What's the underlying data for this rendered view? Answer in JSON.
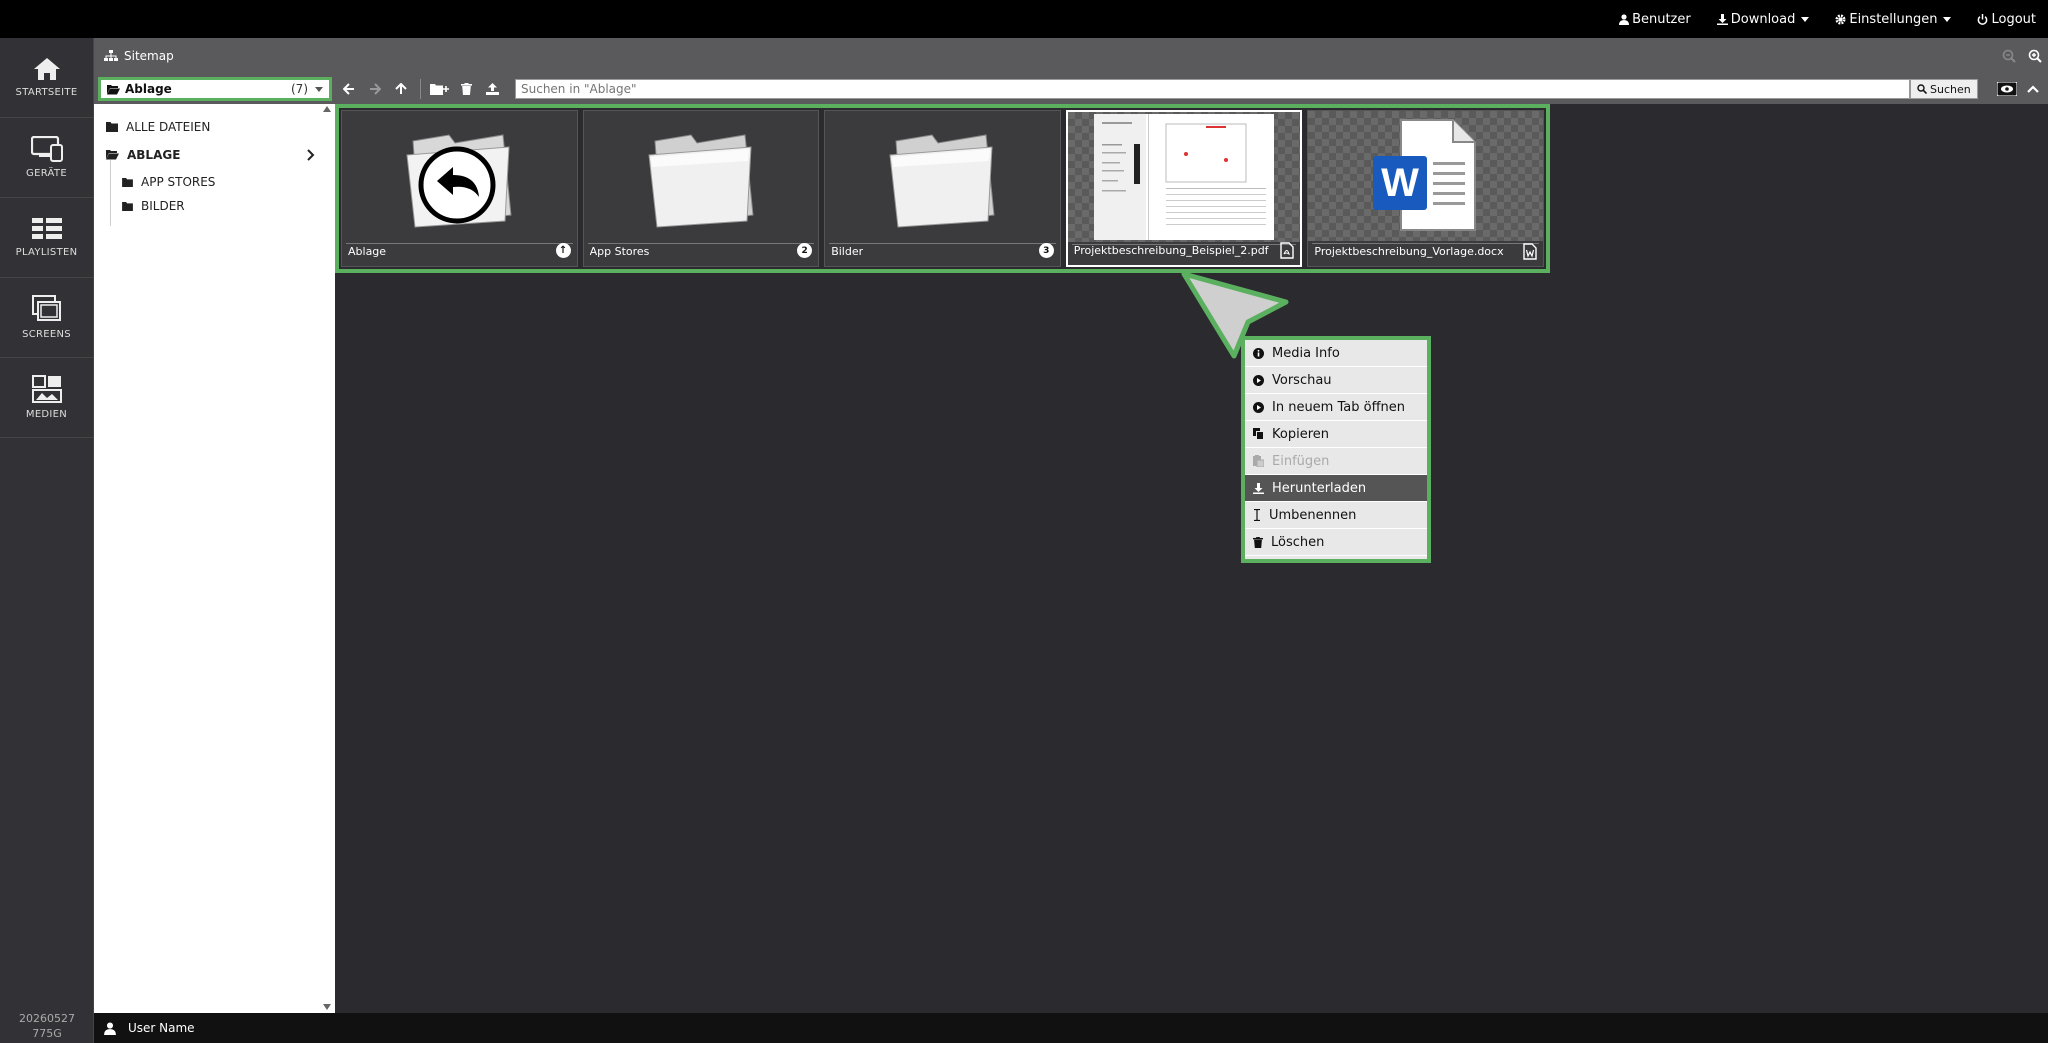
{
  "topbar": {
    "user": "Benutzer",
    "download": "Download",
    "settings": "Einstellungen",
    "logout": "Logout"
  },
  "sidebar": {
    "items": [
      {
        "label": "STARTSEITE",
        "icon": "home-icon"
      },
      {
        "label": "GERÄTE",
        "icon": "devices-icon"
      },
      {
        "label": "PLAYLISTEN",
        "icon": "playlist-icon"
      },
      {
        "label": "SCREENS",
        "icon": "screens-icon"
      },
      {
        "label": "MEDIEN",
        "icon": "media-icon"
      }
    ],
    "version_line1": "20260527",
    "version_line2": "775G"
  },
  "breadcrumb": {
    "label": "Sitemap"
  },
  "toolbar": {
    "folder_name": "Ablage",
    "folder_count": "(7)",
    "search_placeholder": "Suchen in \"Ablage\"",
    "search_button": "Suchen"
  },
  "tree": {
    "all_files": "ALLE DATEIEN",
    "current": "ABLAGE",
    "children": [
      "APP STORES",
      "BILDER"
    ]
  },
  "files": [
    {
      "name": "Ablage",
      "type": "parent",
      "badge": ""
    },
    {
      "name": "App Stores",
      "type": "folder",
      "badge": "2"
    },
    {
      "name": "Bilder",
      "type": "folder",
      "badge": "3"
    },
    {
      "name": "Projektbeschreibung_Beispiel_2.pdf",
      "type": "pdf",
      "badge": ""
    },
    {
      "name": "Projektbeschreibung_Vorlage.docx",
      "type": "docx",
      "badge": ""
    }
  ],
  "context_menu": {
    "items": [
      {
        "label": "Media Info",
        "icon": "info-icon",
        "state": "normal"
      },
      {
        "label": "Vorschau",
        "icon": "play-icon",
        "state": "normal"
      },
      {
        "label": "In neuem Tab öffnen",
        "icon": "play-icon",
        "state": "normal"
      },
      {
        "label": "Kopieren",
        "icon": "copy-icon",
        "state": "normal"
      },
      {
        "label": "Einfügen",
        "icon": "paste-icon",
        "state": "disabled"
      },
      {
        "label": "Herunterladen",
        "icon": "download-icon",
        "state": "active"
      },
      {
        "label": "Umbenennen",
        "icon": "text-cursor-icon",
        "state": "normal"
      },
      {
        "label": "Löschen",
        "icon": "trash-icon",
        "state": "normal"
      }
    ]
  },
  "statusbar": {
    "username": "User Name"
  },
  "colors": {
    "highlight": "#5bb060",
    "word_blue": "#185abd"
  }
}
